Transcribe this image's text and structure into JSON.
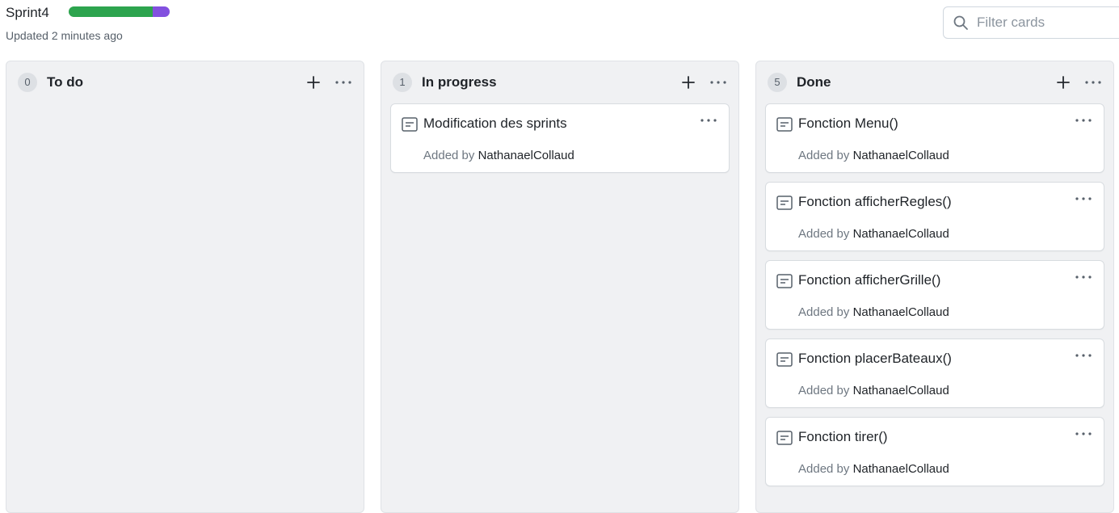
{
  "project": {
    "title": "Sprint4",
    "updated": "Updated 2 minutes ago",
    "progress": {
      "done_fraction": 0.83,
      "in_progress_fraction": 0.17,
      "done_color": "#2da44e",
      "in_progress_color": "#8250df"
    }
  },
  "filter": {
    "placeholder": "Filter cards",
    "value": ""
  },
  "columns": [
    {
      "count": "0",
      "title": "To do",
      "cards": []
    },
    {
      "count": "1",
      "title": "In progress",
      "cards": [
        {
          "title": "Modification des sprints",
          "added_prefix": "Added by",
          "author": "NathanaelCollaud"
        }
      ]
    },
    {
      "count": "5",
      "title": "Done",
      "cards": [
        {
          "title": "Fonction Menu()",
          "added_prefix": "Added by",
          "author": "NathanaelCollaud"
        },
        {
          "title": "Fonction afficherRegles()",
          "added_prefix": "Added by",
          "author": "NathanaelCollaud"
        },
        {
          "title": "Fonction afficherGrille()",
          "added_prefix": "Added by",
          "author": "NathanaelCollaud"
        },
        {
          "title": "Fonction placerBateaux()",
          "added_prefix": "Added by",
          "author": "NathanaelCollaud"
        },
        {
          "title": "Fonction tirer()",
          "added_prefix": "Added by",
          "author": "NathanaelCollaud"
        }
      ]
    }
  ],
  "icons": {
    "search": "search-icon",
    "add": "plus-icon",
    "more": "kebab-horizontal-icon",
    "note": "note-icon"
  }
}
